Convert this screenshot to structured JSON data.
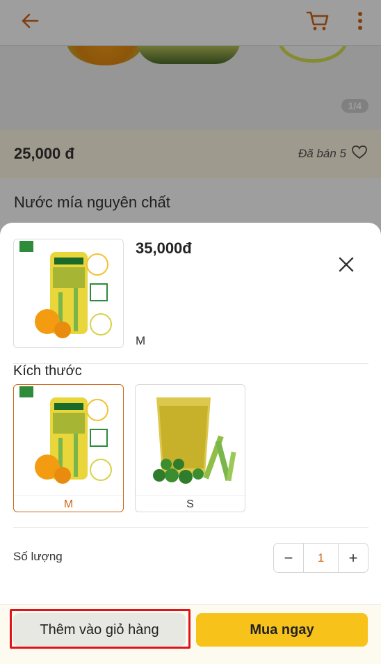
{
  "background": {
    "image_counter": "1/4",
    "price": "25,000 đ",
    "sold": "Đã bán 5",
    "title": "Nước mía nguyên chất"
  },
  "sheet": {
    "price": "35,000đ",
    "selected_variant": "M",
    "size_label": "Kích thước",
    "options": [
      {
        "label": "M",
        "selected": true
      },
      {
        "label": "S",
        "selected": false
      }
    ],
    "quantity_label": "Số lượng",
    "quantity_value": "1",
    "minus": "−",
    "plus": "+",
    "add_to_cart": "Thêm vào giỏ hàng",
    "buy_now": "Mua ngay"
  },
  "icons": [
    "arrow-left-icon",
    "cart-icon",
    "more-vertical-icon",
    "heart-icon",
    "close-icon"
  ],
  "colors": {
    "accent": "#d0661a",
    "buy_button": "#f7c21a",
    "highlight": "#e0131b"
  }
}
